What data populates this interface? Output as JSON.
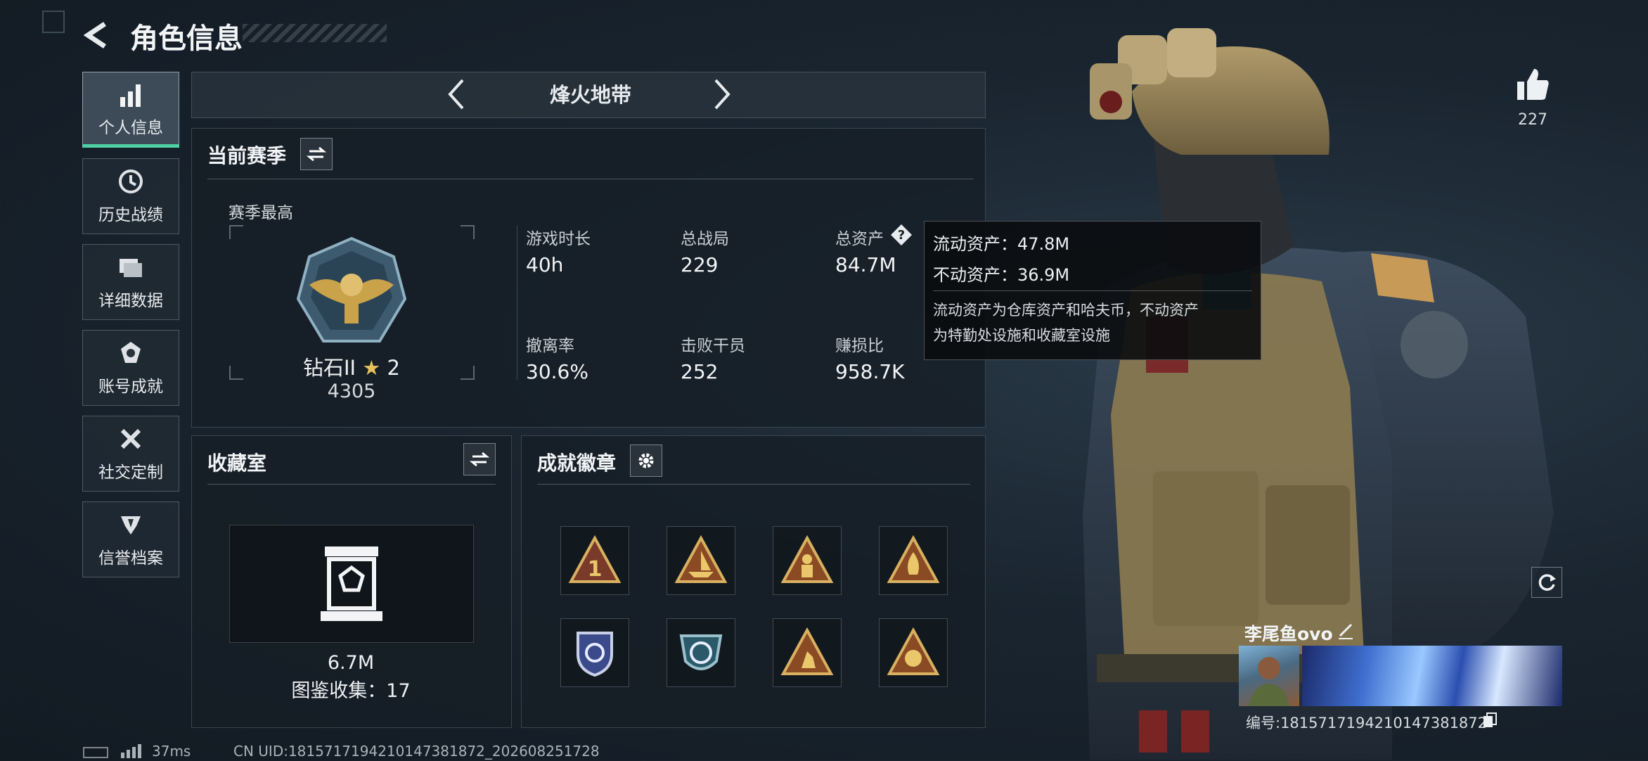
{
  "header": {
    "title": "角色信息"
  },
  "sidebar": {
    "items": [
      {
        "label": "个人信息",
        "icon": "bar-chart-icon",
        "active": true
      },
      {
        "label": "历史战绩",
        "icon": "history-clock-icon"
      },
      {
        "label": "详细数据",
        "icon": "folder-icon"
      },
      {
        "label": "账号成就",
        "icon": "achievement-icon"
      },
      {
        "label": "社交定制",
        "icon": "tools-icon"
      },
      {
        "label": "信誉档案",
        "icon": "reputation-icon"
      }
    ]
  },
  "mode_selector": {
    "current": "烽火地带"
  },
  "season": {
    "title": "当前赛季",
    "best_label": "赛季最高",
    "rank": {
      "name": "钻石II",
      "stars": "2",
      "score": "4305"
    },
    "stats": [
      {
        "label": "游戏时长",
        "value": "40h"
      },
      {
        "label": "总战局",
        "value": "229"
      },
      {
        "label": "总资产",
        "value": "84.7M"
      },
      {
        "label": "撤离率",
        "value": "30.6%"
      },
      {
        "label": "击败干员",
        "value": "252"
      },
      {
        "label": "赚损比",
        "value": "958.7K"
      }
    ]
  },
  "tooltip": {
    "line1": "流动资产：47.8M",
    "line2": "不动资产：36.9M",
    "desc_line1": "流动资产为仓库资产和哈夫币，不动资产",
    "desc_line2": "为特勤处设施和收藏室设施"
  },
  "collection": {
    "title": "收藏室",
    "value": "6.7M",
    "catalog": "图鉴收集：17"
  },
  "achievements": {
    "title": "成就徽章",
    "badges": [
      "badge-triangle-1-icon",
      "badge-triangle-ship-icon",
      "badge-triangle-figure-icon",
      "badge-triangle-fire-icon",
      "badge-shield-icon",
      "badge-crest-icon",
      "badge-triangle-runner-icon",
      "badge-triangle-lion-icon"
    ]
  },
  "likes": {
    "count": "227"
  },
  "player": {
    "name": "李尾鱼ovo",
    "id_text": "编号:1815717194210147381872"
  },
  "status_bar": {
    "ping": "37ms",
    "uid": "CN UID:1815717194210147381872_202608251728"
  },
  "colors": {
    "accent": "#4fd1a5",
    "gold": "#c9a24a",
    "panel": "#161e26"
  }
}
